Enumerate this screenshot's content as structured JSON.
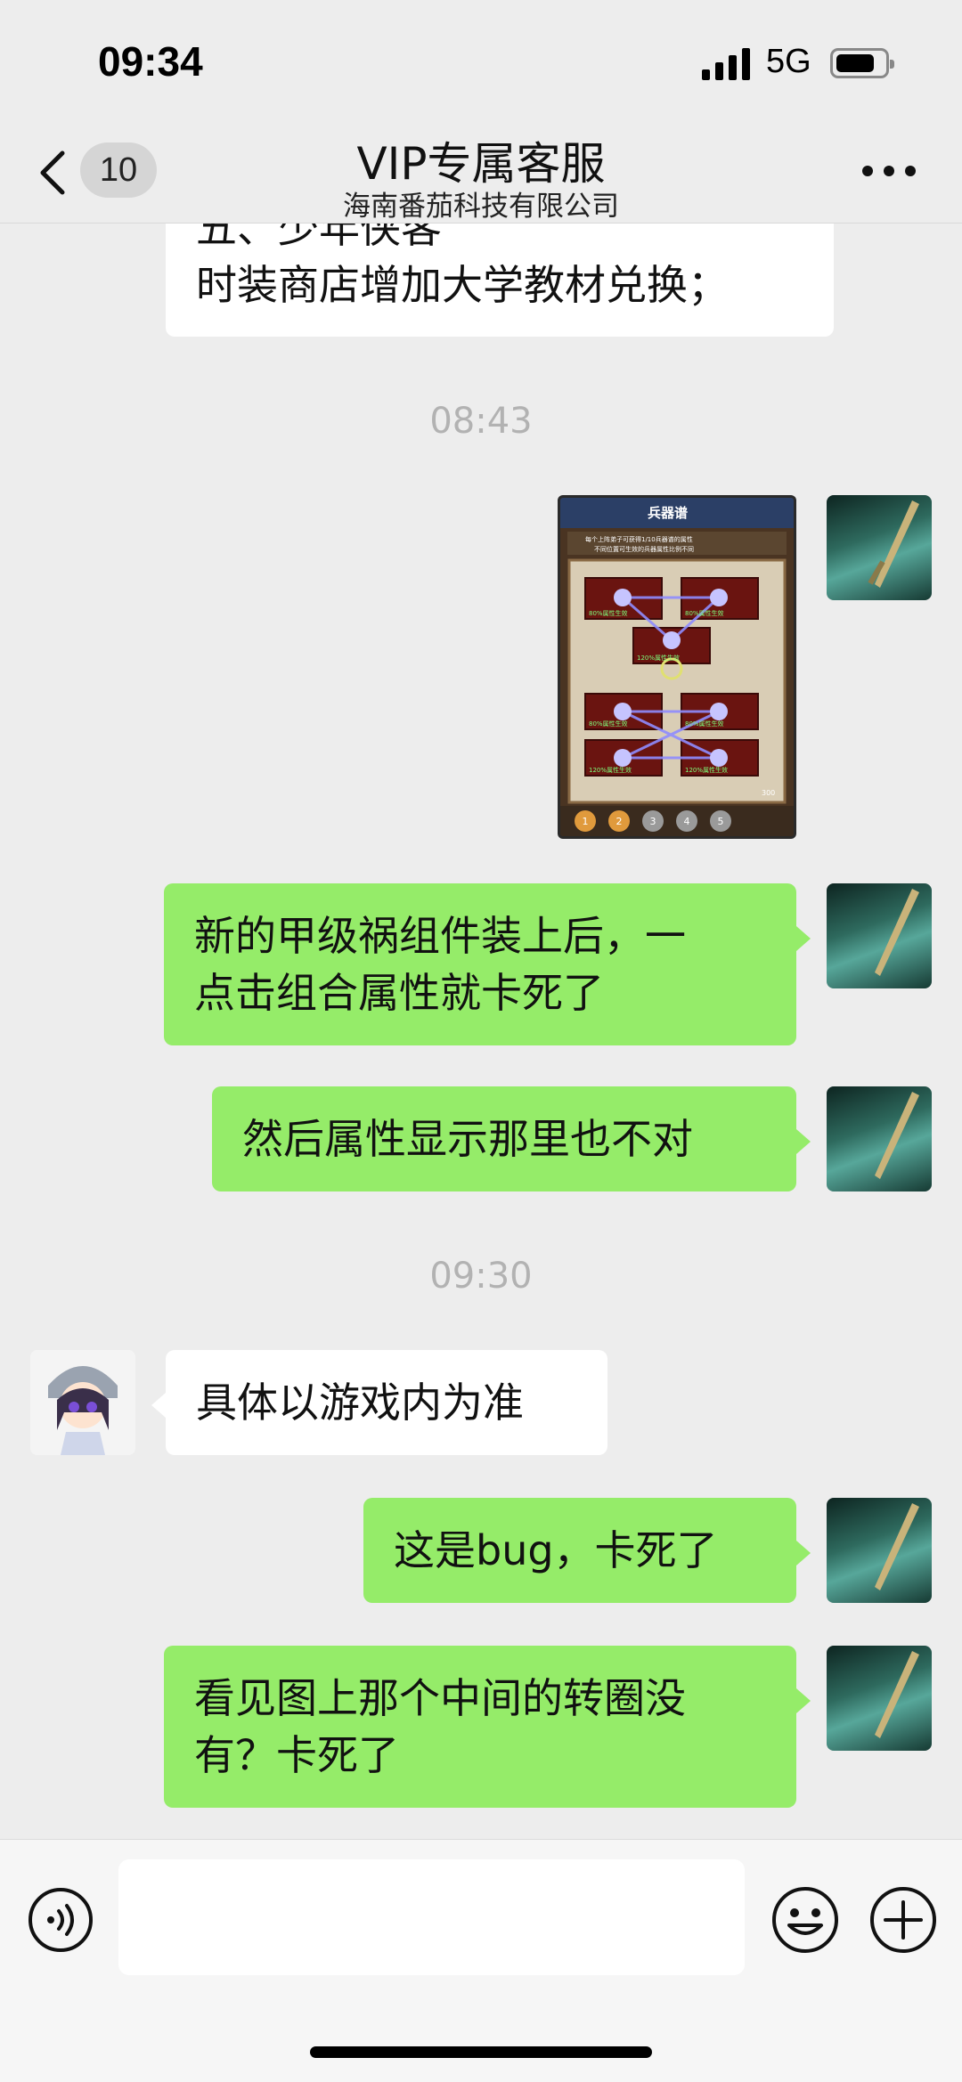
{
  "status_bar": {
    "time": "09:34",
    "network": "5G",
    "battery_level": 0.78
  },
  "nav": {
    "back_count": "10",
    "title": "VIP专属客服",
    "subtitle": "海南番茄科技有限公司"
  },
  "messages": {
    "m0": {
      "line1": "五、少年侠客",
      "line2": "时装商店增加大学教材兑换；"
    },
    "ts1": "08:43",
    "m1_image": {
      "title": "兵器谱",
      "info1": "每个上阵弟子可获得1/10兵器谱的属性",
      "info2": "不同位置可生效的兵器属性比例不同",
      "slot1": "80%属性生效",
      "slot2": "80%属性生效",
      "slot3": "120%属性生效",
      "slot4": "80%属性生效",
      "slot5": "80%属性生效",
      "slot6": "120%属性生效",
      "slot7": "120%属性生效",
      "tabs": [
        "1",
        "2",
        "3",
        "4",
        "5"
      ],
      "points": "300"
    },
    "m2": {
      "line1": "新的甲级祸组件装上后，一",
      "line2": "点击组合属性就卡死了"
    },
    "m3": "然后属性显示那里也不对",
    "ts2": "09:30",
    "m4": "具体以游戏内为准",
    "m5": "这是bug，卡死了",
    "m6": {
      "line1": "看见图上那个中间的转圈没",
      "line2": "有？卡死了"
    }
  },
  "input": {
    "value": ""
  },
  "icons": {
    "back": "chevron-left-icon",
    "more": "more-dots-icon",
    "voice": "voice-icon",
    "emoji": "emoji-icon",
    "plus": "plus-icon"
  },
  "colors": {
    "background": "#ededed",
    "bubble_self": "#95ec69",
    "bubble_other": "#ffffff"
  }
}
